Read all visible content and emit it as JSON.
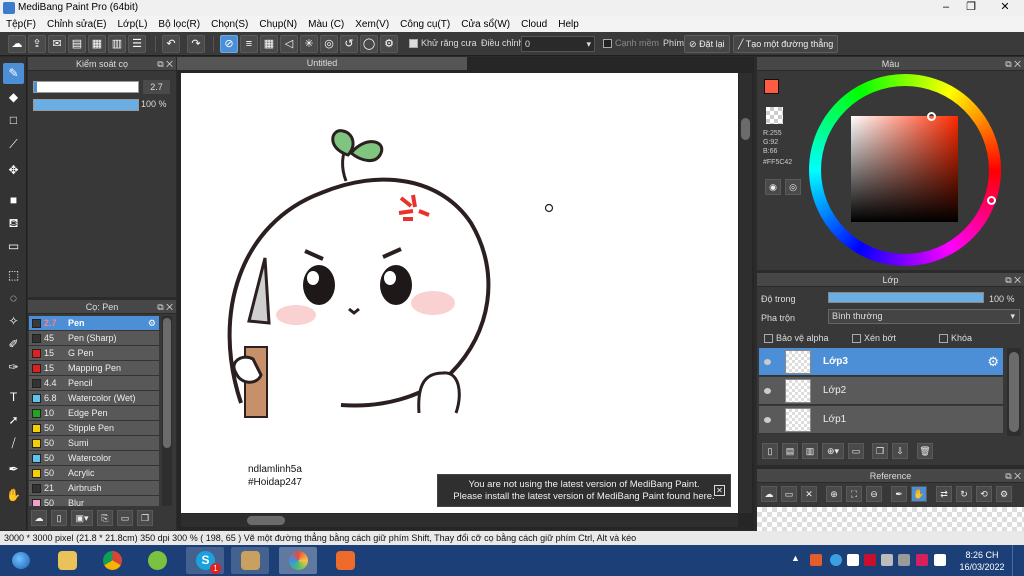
{
  "window": {
    "title": "MediBang Paint Pro (64bit)"
  },
  "menu": [
    "Tệp(F)",
    "Chỉnh sửa(E)",
    "Lớp(L)",
    "Bộ lọc(R)",
    "Chọn(S)",
    "Chụp(N)",
    "Màu (C)",
    "Xem(V)",
    "Công cụ(T)",
    "Cửa sổ(W)",
    "Cloud",
    "Help"
  ],
  "toolbar": {
    "antialias_label": "Khử răng cưa",
    "adjust_label": "Điều chỉnh",
    "adjust_value": "0",
    "snap_edge_label": "Cạnh mềm",
    "shortcut_label": "Phím",
    "reset_label": "Đặt lại",
    "line_label": "Tạo một đường thẳng"
  },
  "brush_control": {
    "title": "Kiểm soát cọ",
    "size_value": "2.7",
    "size_fraction": 0.027,
    "opacity_value": "100 %",
    "opacity_fraction": 1.0
  },
  "brush_panel": {
    "title": "Cọ: Pen",
    "brushes": [
      {
        "size": "2.7",
        "name": "Pen",
        "color": "#3a3a3a",
        "selected": true
      },
      {
        "size": "45",
        "name": "Pen (Sharp)",
        "color": "#333333"
      },
      {
        "size": "15",
        "name": "G Pen",
        "color": "#e02020"
      },
      {
        "size": "15",
        "name": "Mapping Pen",
        "color": "#e02020"
      },
      {
        "size": "4.4",
        "name": "Pencil",
        "color": "#333333"
      },
      {
        "size": "6.8",
        "name": "Watercolor (Wet)",
        "color": "#5fc3f0"
      },
      {
        "size": "10",
        "name": "Edge Pen",
        "color": "#1fa51f"
      },
      {
        "size": "50",
        "name": "Stipple Pen",
        "color": "#f5d000"
      },
      {
        "size": "50",
        "name": "Sumi",
        "color": "#f5d000"
      },
      {
        "size": "50",
        "name": "Watercolor",
        "color": "#5fc3f0"
      },
      {
        "size": "50",
        "name": "Acrylic",
        "color": "#f5d000"
      },
      {
        "size": "21",
        "name": "Airbrush",
        "color": "#333333"
      },
      {
        "size": "50",
        "name": "Blur",
        "color": "#f2a0c8"
      }
    ]
  },
  "document": {
    "tab": "Untitled",
    "watermark_line1": "ndlamlinh5a",
    "watermark_line2": "#Hoidap247"
  },
  "notice": {
    "line1": "You are not using the latest version of MediBang Paint.",
    "line2": "Please install the latest version of MediBang Paint found here."
  },
  "color_panel": {
    "title": "Màu",
    "r": "R:255",
    "g": "G:92",
    "b": "B:66",
    "hex": "#FF5C42",
    "foreground": "#FF5C42"
  },
  "layer_panel": {
    "title": "Lớp",
    "opacity_label": "Độ trong",
    "opacity_value": "100 %",
    "opacity_fraction": 1.0,
    "blend_label": "Pha trộn",
    "blend_value": "Bình thường",
    "protect_alpha": "Bảo vệ alpha",
    "clipping": "Xén bớt",
    "lock": "Khóa",
    "layers": [
      {
        "name": "Lớp3",
        "selected": true
      },
      {
        "name": "Lớp2",
        "selected": false
      },
      {
        "name": "Lớp1",
        "selected": false
      }
    ]
  },
  "reference_panel": {
    "title": "Reference"
  },
  "status": {
    "size": "3000 * 3000 pixel",
    "physical": "(21.8 * 21.8cm)",
    "dpi": "350 dpi",
    "zoom": "300 %",
    "coords": "( 198, 65 )",
    "hint": "Vẽ một đường thẳng bằng cách giữ phím Shift, Thay đổi cỡ cọ bằng cách giữ phím Ctrl, Alt và kéo"
  },
  "taskbar": {
    "time": "8:26 CH",
    "date": "16/03/2022",
    "app_badge": "1"
  },
  "icons": [
    "windows-start-icon",
    "folder-icon",
    "chrome-icon",
    "skype-icon",
    "paint-icon",
    "medibang-icon",
    "shield-icon"
  ]
}
